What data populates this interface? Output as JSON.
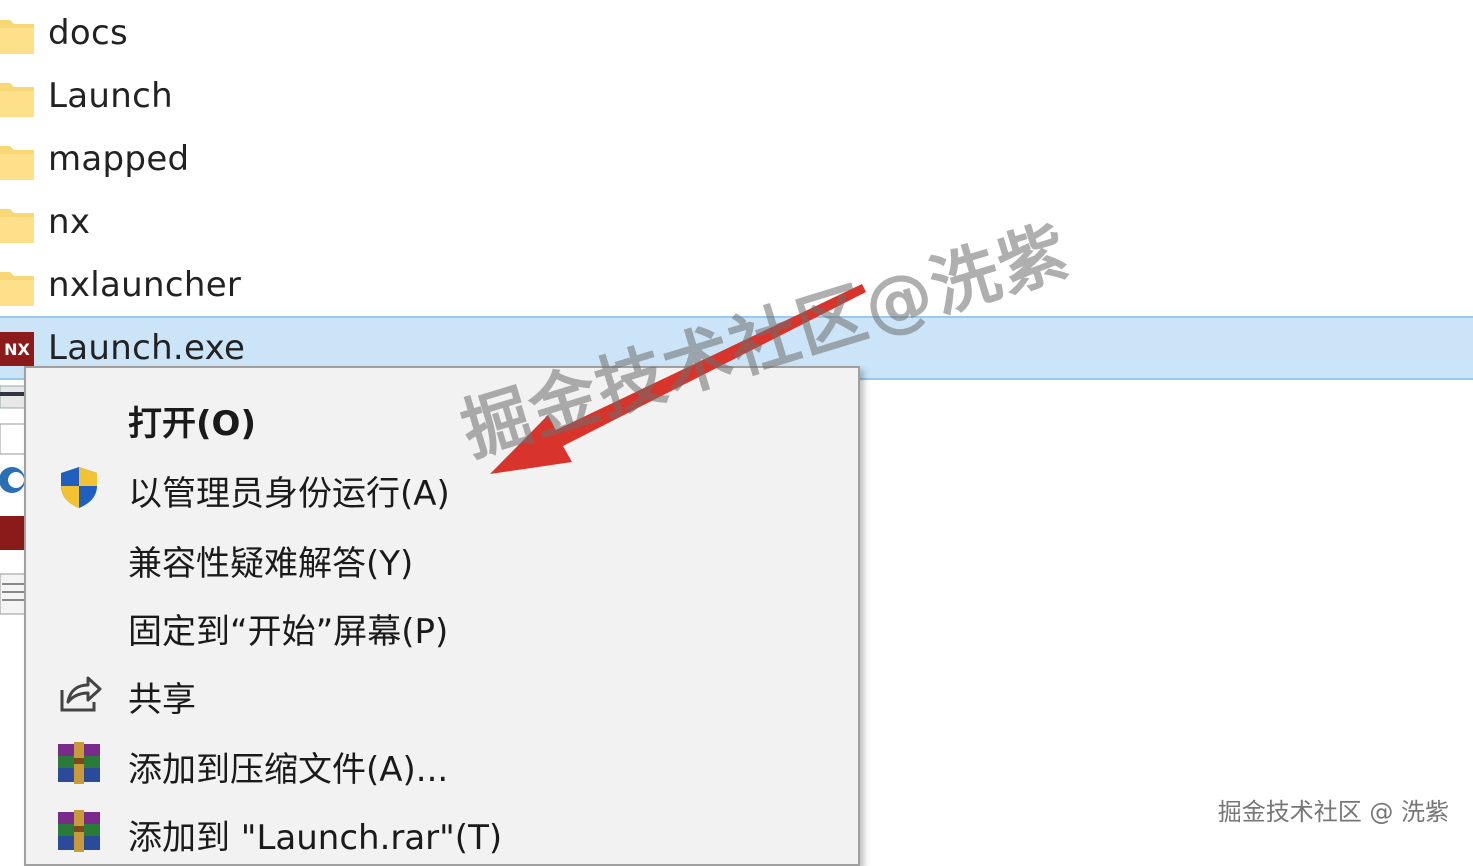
{
  "files": [
    {
      "name": "docs",
      "type": "folder"
    },
    {
      "name": "Launch",
      "type": "folder"
    },
    {
      "name": "mapped",
      "type": "folder"
    },
    {
      "name": "nx",
      "type": "folder"
    },
    {
      "name": "nxlauncher",
      "type": "folder"
    },
    {
      "name": "Launch.exe",
      "type": "exe",
      "icon_text": "NX",
      "selected": true
    }
  ],
  "context_menu": {
    "items": [
      {
        "label": "打开(O)",
        "icon": "",
        "bold": true
      },
      {
        "label": "以管理员身份运行(A)",
        "icon": "uac-shield-icon"
      },
      {
        "label": "兼容性疑难解答(Y)",
        "icon": ""
      },
      {
        "label": "固定到“开始”屏幕(P)",
        "icon": ""
      },
      {
        "label": "共享",
        "icon": "share-icon"
      },
      {
        "label": "添加到压缩文件(A)...",
        "icon": "winrar-icon"
      },
      {
        "label": "添加到 \"Launch.rar\"(T)",
        "icon": "winrar-icon"
      }
    ]
  },
  "watermark": {
    "center": "掘金技术社区@洗紫",
    "corner": "掘金技术社区 @ 洗紫"
  },
  "colors": {
    "selection": "#cce4f7",
    "arrow": "#d9342b",
    "folder": "#f8d775"
  }
}
